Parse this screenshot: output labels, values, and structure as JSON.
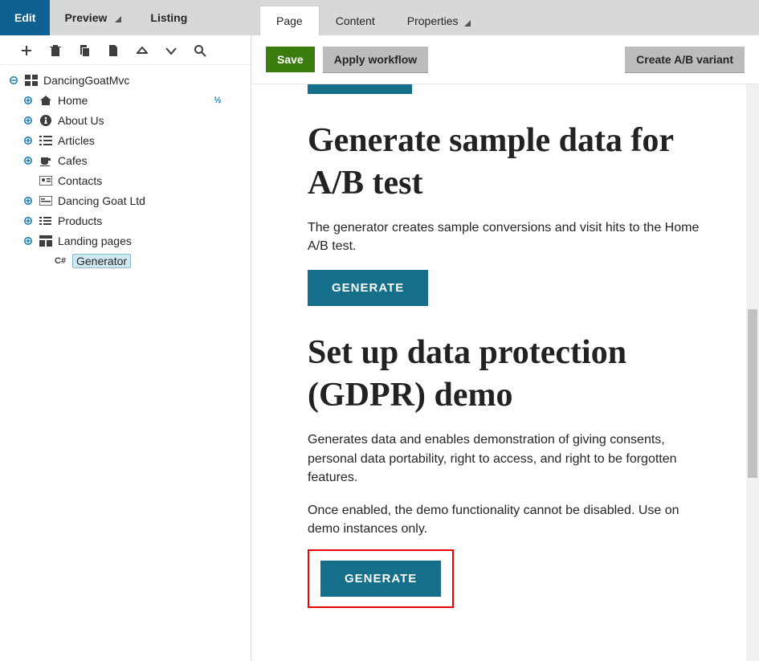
{
  "sidebar": {
    "tabs": {
      "edit": "Edit",
      "preview": "Preview",
      "listing": "Listing"
    },
    "root": "DancingGoatMvc",
    "items": [
      {
        "label": "Home"
      },
      {
        "label": "About Us"
      },
      {
        "label": "Articles"
      },
      {
        "label": "Cafes"
      },
      {
        "label": "Contacts"
      },
      {
        "label": "Dancing Goat Ltd"
      },
      {
        "label": "Products"
      },
      {
        "label": "Landing pages"
      },
      {
        "label": "Generator"
      }
    ]
  },
  "main": {
    "tabs": {
      "page": "Page",
      "content": "Content",
      "properties": "Properties"
    },
    "actions": {
      "save": "Save",
      "workflow": "Apply workflow",
      "abvariant": "Create A/B variant"
    }
  },
  "content": {
    "sections": [
      {
        "title": "Generate sample data for A/B test",
        "paragraphs": [
          "The generator creates sample conversions and visit hits to the Home A/B test."
        ],
        "button": "GENERATE"
      },
      {
        "title": "Set up data protection (GDPR) demo",
        "paragraphs": [
          "Generates data and enables demonstration of giving consents, personal data portability, right to access, and right to be forgotten features.",
          "Once enabled, the demo functionality cannot be disabled. Use on demo instances only."
        ],
        "button": "GENERATE"
      }
    ]
  }
}
